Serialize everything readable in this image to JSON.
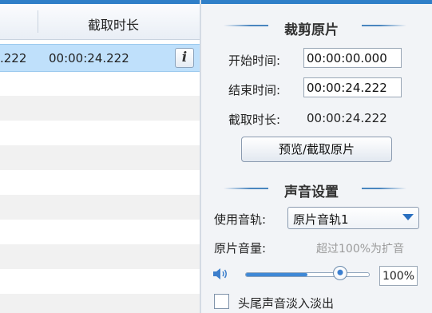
{
  "list": {
    "header_duration": "截取时长",
    "selected_row": {
      "start_partial": ".222",
      "duration": "00:00:24.222"
    },
    "info_button_label": "i"
  },
  "trim": {
    "title": "裁剪原片",
    "start_label": "开始时间:",
    "start_value": "00:00:00.000",
    "end_label": "结束时间:",
    "end_value": "00:00:24.222",
    "duration_label": "截取时长:",
    "duration_value": "00:00:24.222",
    "preview_button": "预览/截取原片"
  },
  "audio": {
    "title": "声音设置",
    "track_label": "使用音轨:",
    "track_value": "原片音轨1",
    "volume_label": "原片音量:",
    "volume_hint": "超过100%为扩音",
    "volume_value": "100%",
    "volume_level": 0.5,
    "fade_label": "头尾声音淡入淡出",
    "fade_checked": false
  },
  "colors": {
    "accent": "#2f7fc8",
    "selection": "#bfe0fb",
    "panel": "#f2f4f7"
  },
  "icons": {
    "info": "info-icon",
    "volume": "speaker-icon",
    "dropdown": "chevron-down-icon"
  }
}
